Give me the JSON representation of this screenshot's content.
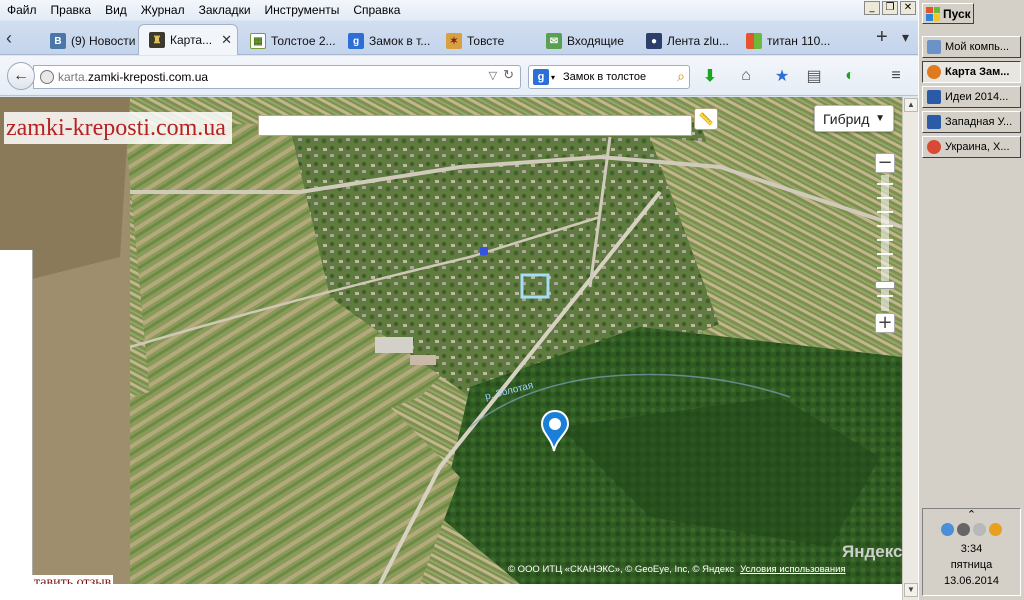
{
  "menu": {
    "items": [
      "Файл",
      "Правка",
      "Вид",
      "Журнал",
      "Закладки",
      "Инструменты",
      "Справка"
    ]
  },
  "window_controls": {
    "minimize": "_",
    "restore": "❐",
    "close": "✕"
  },
  "tabs": [
    {
      "label": "(9) Новости",
      "icon": "vk-icon"
    },
    {
      "label": "Карта...",
      "icon": "castle-icon",
      "active": true
    },
    {
      "label": "Толстое 2...",
      "icon": "site-icon"
    },
    {
      "label": "Замок в т...",
      "icon": "google-icon"
    },
    {
      "label": "Товсте",
      "icon": "coat-icon"
    },
    {
      "label": "Входящие",
      "icon": "mail-icon"
    },
    {
      "label": "Лента zlu...",
      "icon": "user-icon"
    },
    {
      "label": "титан 110...",
      "icon": "windows-icon"
    }
  ],
  "tabbar_icons": {
    "scroll_left": "‹",
    "new_tab": "+",
    "list_tabs": "▾"
  },
  "navbar": {
    "url_prefix": "karta.",
    "url_domain": "zamki-kreposti.com.ua",
    "search_text": "Замок в толстое",
    "search_engine_icon": "g"
  },
  "map": {
    "site_logo": "zamki-kreposti.com.ua",
    "map_type": "Гибрид",
    "river_label": "р. Золотая",
    "yandex_logo": "Яндекс",
    "copyright": "© ООО ИТЦ «СКАНЭКС», © GeoEye, Inc, © Яндекс",
    "terms_link": "Условия использования",
    "review_link": "тавить отзыв",
    "zoom_in": "+",
    "zoom_out": "−"
  },
  "taskbar": {
    "start": "Пуск",
    "tasks": [
      {
        "label": "Мой компь...",
        "color": "#6b93c8"
      },
      {
        "label": "Карта Зам...",
        "color": "#e07a1f",
        "active": true
      },
      {
        "label": "Идеи 2014...",
        "color": "#2b5aa6"
      },
      {
        "label": "Западная У...",
        "color": "#2b5aa6"
      },
      {
        "label": "Украина, Х...",
        "color": "#d84a33"
      }
    ],
    "tray": {
      "expand": "⌃",
      "time": "3:34",
      "weekday": "пятница",
      "date": "13.06.2014"
    }
  },
  "colors": {
    "accent": "#2d6fd6",
    "logo_red": "#b62222",
    "marker_blue": "#1a7fd8"
  }
}
